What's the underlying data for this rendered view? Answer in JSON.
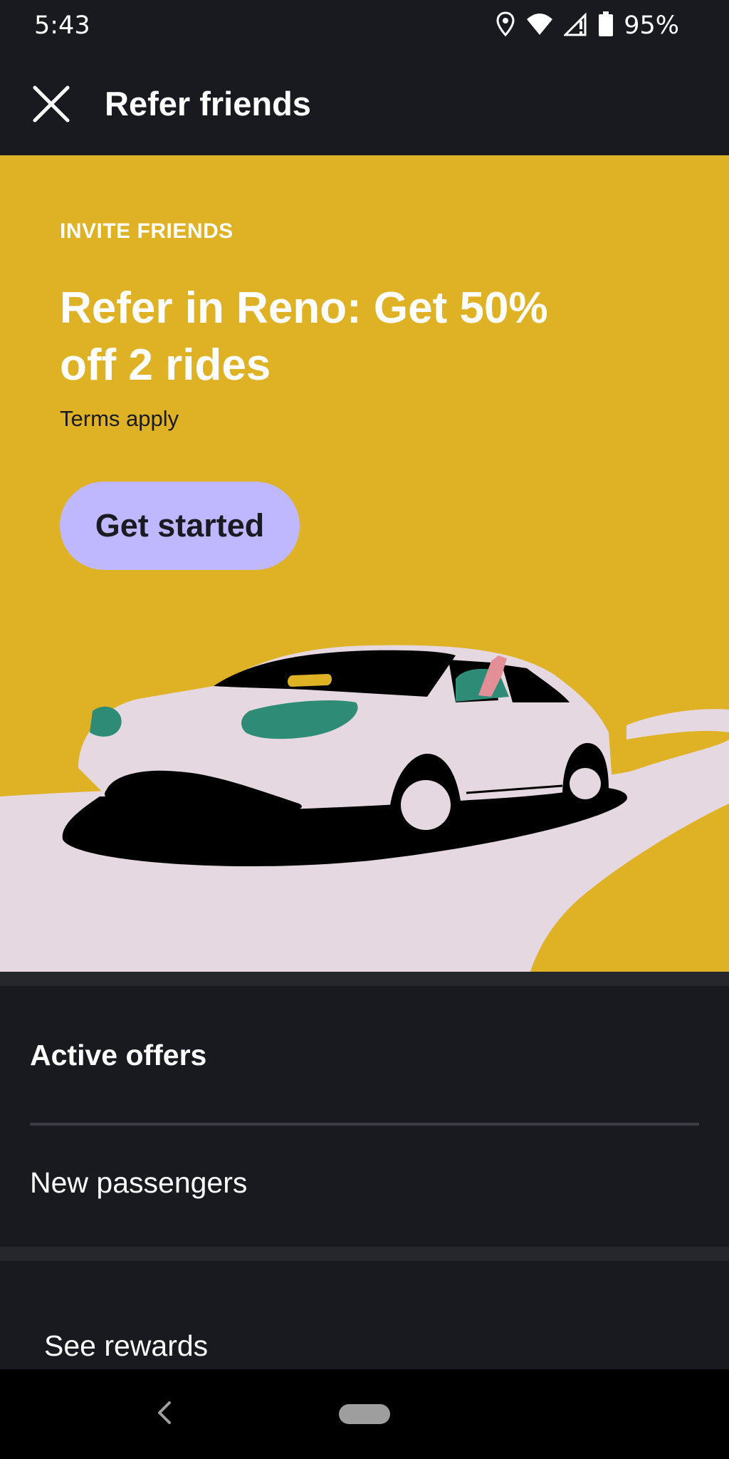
{
  "status_bar": {
    "time": "5:43",
    "battery": "95%",
    "icons": [
      "location-icon",
      "wifi-icon",
      "signal-icon",
      "battery-icon"
    ]
  },
  "header": {
    "title": "Refer friends",
    "close_icon": "close-icon"
  },
  "promo": {
    "eyebrow": "INVITE FRIENDS",
    "headline": "Refer in Reno: Get 50% off 2 rides",
    "terms": "Terms apply",
    "cta_label": "Get started",
    "illustration": "car-illustration"
  },
  "offers": {
    "title": "Active offers",
    "items": [
      {
        "label": "New passengers"
      }
    ]
  },
  "rewards": {
    "label": "See rewards"
  },
  "nav": {
    "back_icon": "back-chevron-icon",
    "home_icon": "home-pill-icon"
  },
  "colors": {
    "background": "#191920",
    "promo_background": "#deb224",
    "cta_background": "#c0b8ff",
    "text_primary": "#ffffff"
  }
}
